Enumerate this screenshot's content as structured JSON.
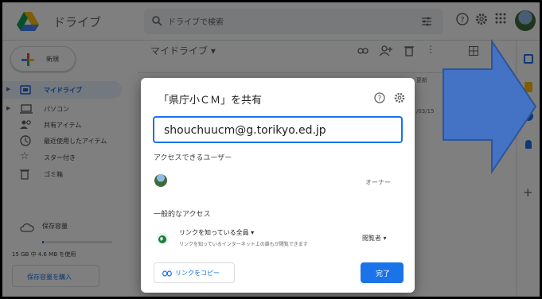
{
  "header": {
    "brand": "ドライブ",
    "search_label": "ドライブで検索"
  },
  "sidebar": {
    "new_label": "新規",
    "items": [
      {
        "label": "マイドライブ",
        "icon": "drive-folder-icon"
      },
      {
        "label": "パソコン",
        "icon": "computer-icon"
      },
      {
        "label": "共有アイテム",
        "icon": "shared-people-icon"
      },
      {
        "label": "最近使用したアイテム",
        "icon": "clock-icon"
      },
      {
        "label": "スター付き",
        "icon": "star-icon"
      },
      {
        "label": "ゴミ箱",
        "icon": "trash-icon"
      }
    ],
    "storage_label": "保存容量",
    "storage_text": "15 GB 中 4.6 MB を使用",
    "buy_label": "保存容量を購入"
  },
  "main": {
    "breadcrumb": "マイドライブ ▾",
    "col_modified": "更新",
    "date_fragment": "/03/15"
  },
  "dialog": {
    "title": "「県庁小ＣＭ」を共有",
    "add_value": "shouchuucm@g.torikyo.ed.jp",
    "access_heading": "アクセスできるユーザー",
    "owner_role": "オーナー",
    "general_heading": "一般的なアクセス",
    "link_setting": "リンクを知っている全員 ▾",
    "link_desc": "リンクを知っているインターネット上の誰もが閲覧できます",
    "role": "閲覧者 ▾",
    "copy_label": "リンクをコピー",
    "done_label": "完了"
  },
  "colors": {
    "accent": "#1a73e8",
    "arrow_fill": "#4472c4",
    "arrow_stroke": "#2f5597"
  }
}
